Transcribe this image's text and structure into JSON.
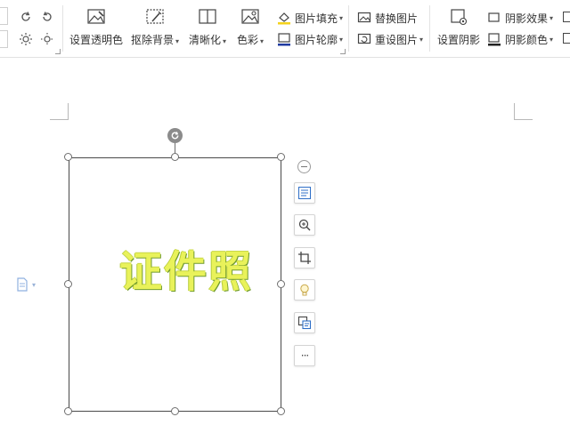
{
  "toolbar": {
    "set_transparent_color": "设置透明色",
    "remove_background": "抠除背景",
    "sharpen": "清晰化",
    "color": "色彩",
    "picture_fill": "图片填充",
    "picture_outline": "图片轮廓",
    "replace_picture": "替换图片",
    "reset_picture": "重设图片",
    "set_shadow": "设置阴影",
    "shadow_effect": "阴影效果",
    "shadow_color": "阴影颜色",
    "caret": "▾"
  },
  "canvas": {
    "picture_text": "证件照",
    "more_label": "···"
  },
  "colors": {
    "accent_blue": "#2f6fc7",
    "picture_text": "#e9f25a",
    "handle_border": "#6e6e6e"
  }
}
